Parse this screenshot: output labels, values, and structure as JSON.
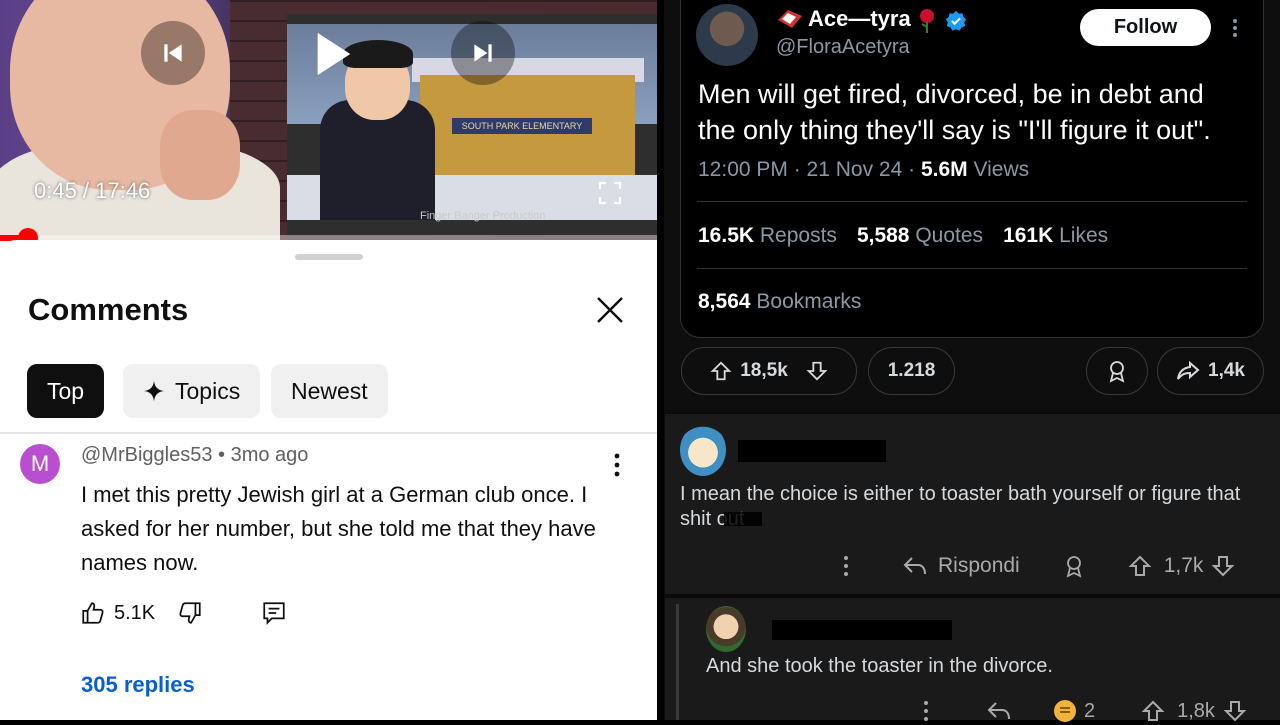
{
  "left": {
    "video": {
      "time_current": "0:45",
      "time_total": "17:46",
      "time_display": "0:45 / 17:46",
      "progress_fraction": 0.042,
      "embedded_caption": "Finger Banger Production",
      "embedded_sign": "SOUTH PARK ELEMENTARY"
    },
    "comments": {
      "title": "Comments",
      "chips": [
        "Top",
        "Topics",
        "Newest"
      ],
      "comment": {
        "avatar_letter": "M",
        "author": "@MrBiggles53",
        "age": "3mo ago",
        "meta": "@MrBiggles53 • 3mo ago",
        "text": "I met this pretty Jewish girl at a German club once. I asked for her number, but she told me that they have names now.",
        "likes": "5.1K",
        "replies": "305 replies"
      }
    }
  },
  "right": {
    "tweet": {
      "name": "Ace—tyra",
      "handle": "@FloraAcetyra",
      "follow_label": "Follow",
      "text": "Men will get fired, divorced, be in debt and the only thing they'll say is \"I'll figure it out\".",
      "time": "12:00 PM · 21 Nov 24 · ",
      "views_count": "5.6M",
      "views_label": "Views",
      "reposts_count": "16.5K",
      "reposts_label": "Reposts",
      "quotes_count": "5,588",
      "quotes_label": "Quotes",
      "likes_count": "161K",
      "likes_label": "Likes",
      "bookmarks_count": "8,564",
      "bookmarks_label": "Bookmarks"
    },
    "post_actions": {
      "upvotes": "18,5k",
      "comments": "1.218",
      "shares": "1,4k"
    },
    "comment1": {
      "text": "I mean the choice is either to toaster bath yourself or figure that shit out",
      "reply_label": "Rispondi",
      "votes": "1,7k"
    },
    "comment2": {
      "text": "And she took the toaster in the divorce.",
      "awards": "2",
      "votes": "1,8k"
    },
    "colors": {
      "verified": "#1d9bf0",
      "youtube_red": "#ff0000",
      "link_blue": "#065fd4"
    }
  }
}
